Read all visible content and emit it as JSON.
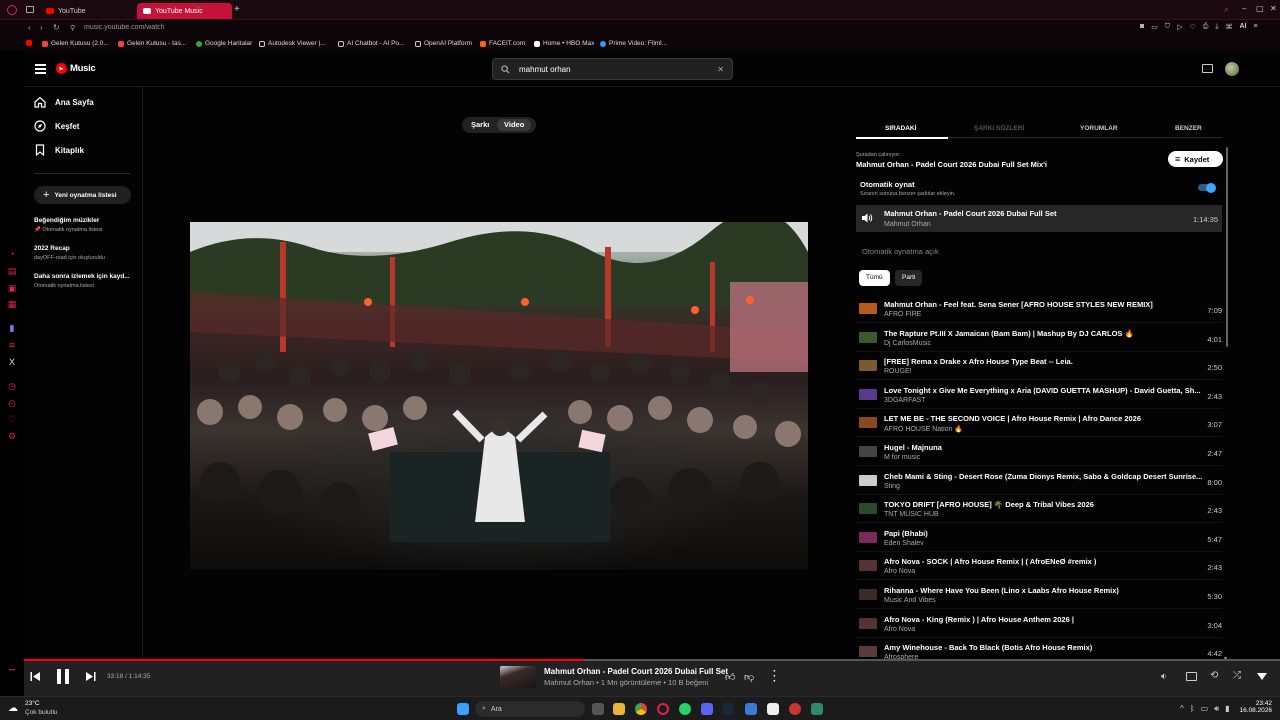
{
  "browser": {
    "tabs": [
      {
        "title": "YouTube"
      },
      {
        "title": "YouTube Music"
      }
    ],
    "url": "music.youtube.com/watch",
    "bookmarks": [
      "Gelen Kutusu (2.0...",
      "Gelen Kutusu - tas...",
      "Google Haritalar",
      "Autodesk Viewer |...",
      "AI Chatbot - AI Po...",
      "OpenAI Platform",
      "FACEIT.com",
      "Home • HBO Max",
      "Prime Video: Filml..."
    ],
    "ext_label": "AI"
  },
  "app": {
    "logo": "Music",
    "search_value": "mahmut orhan"
  },
  "sidebar": {
    "nav": [
      {
        "label": "Ana Sayfa",
        "icon": "home-icon"
      },
      {
        "label": "Keşfet",
        "icon": "explore-icon"
      },
      {
        "label": "Kitaplık",
        "icon": "library-icon"
      }
    ],
    "new_playlist": "Yeni oynatma listesi",
    "playlists": [
      {
        "title": "Beğendiğim müzikler",
        "subtitle": "Otomatik oynatma listesi"
      },
      {
        "title": "2022 Recap",
        "subtitle": "dayOFF-road için oluşturuldu"
      },
      {
        "title": "Daha sonra izlemek için kayd...",
        "subtitle": "Otomatik oynatma listesi"
      }
    ]
  },
  "toggle": {
    "song": "Şarkı",
    "video": "Video",
    "active": "Video"
  },
  "panel": {
    "tabs": [
      "SIRADAKİ",
      "ŞARKI SÖZLERİ",
      "YORUMLAR",
      "BENZER"
    ],
    "playing_from_label": "Şuradan çalınıyor:",
    "playing_from": "Mahmut Orhan - Padel Court 2026 Dubai Full Set Mix'i",
    "save_label": "Kaydet",
    "autoplay_title": "Otomatik oynat",
    "autoplay_desc": "Sıranın sonuna benzer şarkılar ekleyin.",
    "autoplay_on": true,
    "current": {
      "title": "Mahmut Orhan - Padel Court 2026 Dubai Full Set",
      "artist": "Mahmut Orhan",
      "duration": "1:14:35"
    },
    "autoplay_status": "Otomatik oynatma açık",
    "chips": [
      "Tümü",
      "Parti"
    ],
    "queue": [
      {
        "title": "Mahmut Orhan - Feel feat. Sena Sener [AFRO HOUSE STYLES NEW REMIX]",
        "artist": "AFRO FIRE",
        "duration": "7:09",
        "color": "#b85a1a"
      },
      {
        "title": "The Rapture Pt.III X Jamaican (Bam Bam) | Mashup By DJ CARLOS 🔥",
        "artist": "Dj CarlosMusic",
        "duration": "4:01",
        "color": "#3a5a2a"
      },
      {
        "title": "[FREE] Rema x Drake x Afro House Type Beat -- Leia.",
        "artist": "ROUGE!",
        "duration": "2:50",
        "color": "#7a5a30"
      },
      {
        "title": "Love Tonight x Give Me Everything x Aria (DAVID GUETTA MASHUP) - David Guetta, Sh...",
        "artist": "3DGARFAST",
        "duration": "2:43",
        "color": "#5a3a8a"
      },
      {
        "title": "LET ME BE - THE SECOND VOICE | Afro House Remix | Afro Dance 2026",
        "artist": "AFRO HOUSE Nation 🔥",
        "duration": "3:07",
        "color": "#8a4a20"
      },
      {
        "title": "Hugel - Majnuna",
        "artist": "M for music",
        "duration": "2:47",
        "color": "#444444"
      },
      {
        "title": "Cheb Mami & Sting - Desert Rose (Zuma Dionys Remix, Sabo & Goldcap Desert Sunrise...",
        "artist": "Sting",
        "duration": "8:00",
        "color": "#cccccc"
      },
      {
        "title": "TOKYO DRIFT [AFRO HOUSE] 🌴 Deep & Tribal Vibes 2026",
        "artist": "TNT MUSIC HUB",
        "duration": "2:43",
        "color": "#2a4a2a"
      },
      {
        "title": "Papi (Bhabi)",
        "artist": "Eden Shalev",
        "duration": "5:47",
        "color": "#7a2a5a"
      },
      {
        "title": "Afro Nova - SOCK | Afro House Remix | ( AfroENeØ #remix )",
        "artist": "Afro Nova",
        "duration": "2:43",
        "color": "#553333"
      },
      {
        "title": "Rihanna - Where Have You Been (Lino x Laabs Afro House Remix)",
        "artist": "Music And Vibes",
        "duration": "5:30",
        "color": "#3a2a2a"
      },
      {
        "title": "Afro Nova - King (Remix ) | Afro House Anthem 2026 |",
        "artist": "Afro Nova",
        "duration": "3:04",
        "color": "#553333"
      },
      {
        "title": "Amy Winehouse - Back To Black (Botis Afro House Remix)",
        "artist": "Afrosphere",
        "duration": "4:42",
        "color": "#5a3a3a"
      }
    ]
  },
  "player": {
    "time": "33:18 / 1:14:35",
    "progress": 0.446,
    "title": "Mahmut Orhan - Padel Court 2026 Dubai Full Set",
    "meta": "Mahmut Orhan • 1 Mn görüntüleme • 10 B beğeni"
  },
  "taskbar": {
    "temp": "23°C",
    "weather": "Çok bulutlu",
    "search": "Ara",
    "time": "23:42",
    "date": "16.08.2026"
  },
  "colors": {
    "accent": "#ff0000",
    "browser_accent": "#c4123a",
    "toggle_on": "#3ea6ff"
  }
}
